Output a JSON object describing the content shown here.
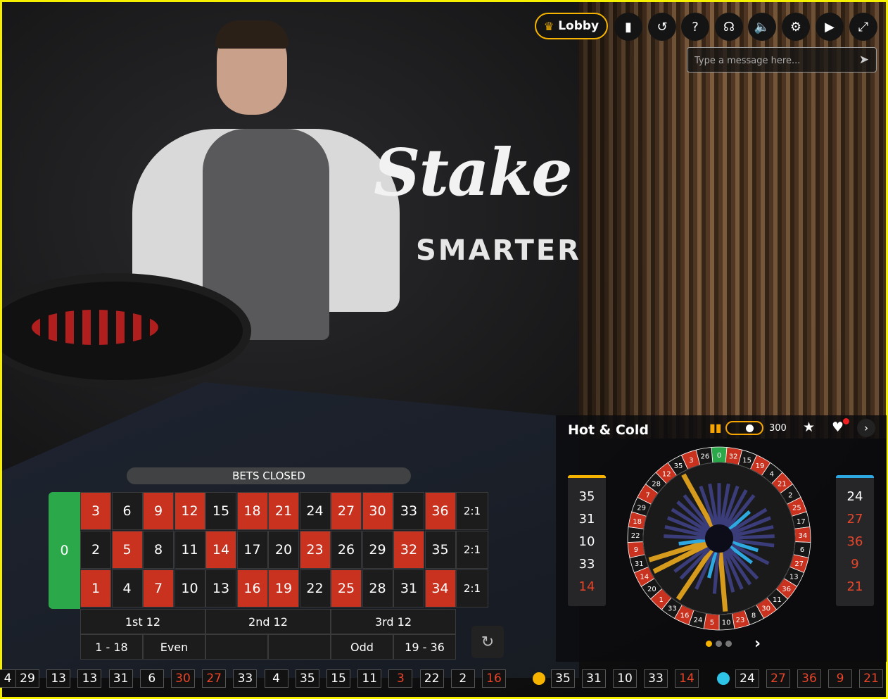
{
  "scene": {
    "logo_text": "Stake",
    "tagline": "SMARTER"
  },
  "toolbar": {
    "lobby_label": "Lobby",
    "icons": [
      "chat-icon",
      "history-icon",
      "help-icon",
      "support-icon",
      "mute-icon",
      "settings-icon",
      "video-icon",
      "fullscreen-icon"
    ]
  },
  "chat": {
    "placeholder": "Type a message here..."
  },
  "status": {
    "bets_closed": "BETS CLOSED"
  },
  "board": {
    "zero": "0",
    "columns": [
      [
        "3",
        "2",
        "1"
      ],
      [
        "6",
        "5",
        "4"
      ],
      [
        "9",
        "8",
        "7"
      ],
      [
        "12",
        "11",
        "10"
      ],
      [
        "15",
        "14",
        "13"
      ],
      [
        "18",
        "17",
        "16"
      ],
      [
        "21",
        "20",
        "19"
      ],
      [
        "24",
        "23",
        "22"
      ],
      [
        "27",
        "26",
        "25"
      ],
      [
        "30",
        "29",
        "28"
      ],
      [
        "33",
        "32",
        "31"
      ],
      [
        "36",
        "35",
        "34"
      ]
    ],
    "red_numbers": [
      "1",
      "3",
      "5",
      "7",
      "9",
      "12",
      "14",
      "16",
      "18",
      "19",
      "21",
      "23",
      "25",
      "27",
      "30",
      "32",
      "34",
      "36"
    ],
    "column_bets": [
      "2:1",
      "2:1",
      "2:1"
    ],
    "dozens": [
      "1st 12",
      "2nd 12",
      "3rd 12"
    ],
    "outside": [
      "1 - 18",
      "Even",
      "",
      "",
      "Odd",
      "19 - 36"
    ]
  },
  "hot_cold": {
    "title": "Hot & Cold",
    "spin_count": "300",
    "hot": [
      {
        "n": "35",
        "red": false
      },
      {
        "n": "31",
        "red": false
      },
      {
        "n": "10",
        "red": false
      },
      {
        "n": "33",
        "red": false
      },
      {
        "n": "14",
        "red": true
      }
    ],
    "cold": [
      {
        "n": "24",
        "red": false
      },
      {
        "n": "27",
        "red": true
      },
      {
        "n": "36",
        "red": true
      },
      {
        "n": "9",
        "red": true
      },
      {
        "n": "21",
        "red": true
      }
    ],
    "wheel_order": [
      "0",
      "32",
      "15",
      "19",
      "4",
      "21",
      "2",
      "25",
      "17",
      "34",
      "6",
      "27",
      "13",
      "36",
      "11",
      "30",
      "8",
      "23",
      "10",
      "5",
      "24",
      "16",
      "33",
      "1",
      "20",
      "14",
      "31",
      "9",
      "22",
      "18",
      "29",
      "7",
      "28",
      "12",
      "35",
      "3",
      "26"
    ],
    "hot_numbers": [
      "35",
      "31",
      "10",
      "33",
      "14"
    ],
    "cold_numbers": [
      "24",
      "27",
      "36",
      "9",
      "21"
    ]
  },
  "history_strip": [
    {
      "n": "4",
      "red": false
    },
    {
      "n": "29",
      "red": false
    },
    {
      "n": "13",
      "red": false
    },
    {
      "n": "13",
      "red": false
    },
    {
      "n": "31",
      "red": false
    },
    {
      "n": "6",
      "red": false
    },
    {
      "n": "30",
      "red": true
    },
    {
      "n": "27",
      "red": true
    },
    {
      "n": "33",
      "red": false
    },
    {
      "n": "4",
      "red": false
    },
    {
      "n": "35",
      "red": false
    },
    {
      "n": "15",
      "red": false
    },
    {
      "n": "11",
      "red": false
    },
    {
      "n": "3",
      "red": true
    },
    {
      "n": "22",
      "red": false
    },
    {
      "n": "2",
      "red": false
    },
    {
      "n": "16",
      "red": true
    }
  ],
  "hot_strip": [
    {
      "n": "35",
      "red": false
    },
    {
      "n": "31",
      "red": false
    },
    {
      "n": "10",
      "red": false
    },
    {
      "n": "33",
      "red": false
    },
    {
      "n": "14",
      "red": true
    }
  ],
  "cold_strip": [
    {
      "n": "24",
      "red": false
    },
    {
      "n": "27",
      "red": true
    },
    {
      "n": "36",
      "red": true
    },
    {
      "n": "9",
      "red": true
    },
    {
      "n": "21",
      "red": true
    }
  ],
  "colors": {
    "red": "#c8321f",
    "black": "#1c1c1c",
    "green": "#2aa84a",
    "accent": "#f6b400",
    "cold": "#2ea8e0"
  }
}
